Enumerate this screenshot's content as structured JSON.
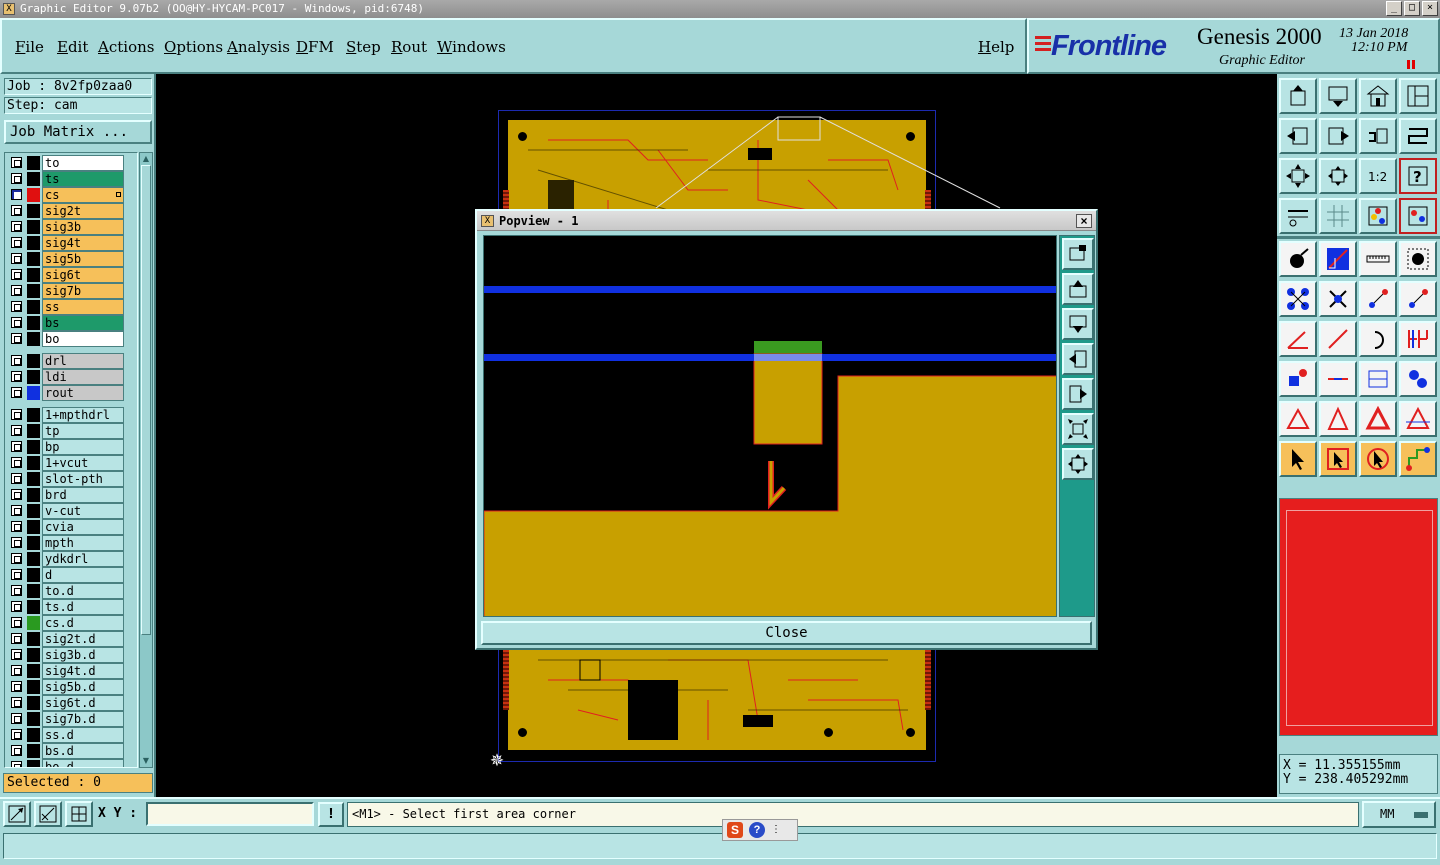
{
  "window": {
    "title": "Graphic Editor 9.07b2 (OO@HY-HYCAM-PC017 - Windows, pid:6748)",
    "app_icon": "X",
    "minimize": "_",
    "maximize": "□",
    "close": "×"
  },
  "menu": {
    "file": "File",
    "edit": "Edit",
    "actions": "Actions",
    "options": "Options",
    "analysis": "Analysis",
    "dfm": "DFM",
    "step": "Step",
    "rout": "Rout",
    "windows": "Windows",
    "help": "Help"
  },
  "brand": {
    "logo": "Frontline",
    "product": "Genesis 2000",
    "subproduct": "Graphic Editor",
    "date": "13 Jan 2018",
    "time": "12:10 PM"
  },
  "job": {
    "job_line": "Job : 8v2fp0zaa0",
    "step_line": "Step: cam",
    "matrix_button": "Job Matrix ..."
  },
  "layers": {
    "board": [
      {
        "name": "to",
        "color": "white",
        "swatch": "#000000"
      },
      {
        "name": "ts",
        "color": "green",
        "swatch": "#000000"
      },
      {
        "name": "cs",
        "color": "orange",
        "swatch": "#e01010",
        "active": true
      },
      {
        "name": "sig2t",
        "color": "orange",
        "swatch": "#000000"
      },
      {
        "name": "sig3b",
        "color": "orange",
        "swatch": "#000000"
      },
      {
        "name": "sig4t",
        "color": "orange",
        "swatch": "#000000"
      },
      {
        "name": "sig5b",
        "color": "orange",
        "swatch": "#000000"
      },
      {
        "name": "sig6t",
        "color": "orange",
        "swatch": "#000000"
      },
      {
        "name": "sig7b",
        "color": "orange",
        "swatch": "#000000"
      },
      {
        "name": "ss",
        "color": "orange",
        "swatch": "#000000"
      },
      {
        "name": "bs",
        "color": "green",
        "swatch": "#000000"
      },
      {
        "name": "bo",
        "color": "white",
        "swatch": "#000000"
      }
    ],
    "drill": [
      {
        "name": "drl",
        "color": "gray",
        "swatch": "#000000"
      },
      {
        "name": "ldi",
        "color": "gray",
        "swatch": "#000000"
      },
      {
        "name": "rout",
        "color": "gray",
        "swatch": "#1030e0"
      }
    ],
    "misc": [
      {
        "name": "1+mpthdrl",
        "color": "teal",
        "swatch": "#000000"
      },
      {
        "name": "tp",
        "color": "teal",
        "swatch": "#000000"
      },
      {
        "name": "bp",
        "color": "teal",
        "swatch": "#000000"
      },
      {
        "name": "1+vcut",
        "color": "teal",
        "swatch": "#000000"
      },
      {
        "name": "slot-pth",
        "color": "teal",
        "swatch": "#000000"
      },
      {
        "name": "brd",
        "color": "teal",
        "swatch": "#000000"
      },
      {
        "name": "v-cut",
        "color": "teal",
        "swatch": "#000000"
      },
      {
        "name": "cvia",
        "color": "teal",
        "swatch": "#000000"
      },
      {
        "name": "mpth",
        "color": "teal",
        "swatch": "#000000"
      },
      {
        "name": "ydkdrl",
        "color": "teal",
        "swatch": "#000000"
      },
      {
        "name": "d",
        "color": "teal",
        "swatch": "#000000"
      },
      {
        "name": "to.d",
        "color": "teal",
        "swatch": "#000000"
      },
      {
        "name": "ts.d",
        "color": "teal",
        "swatch": "#000000"
      },
      {
        "name": "cs.d",
        "color": "teal",
        "swatch": "#2a9a20"
      },
      {
        "name": "sig2t.d",
        "color": "teal",
        "swatch": "#000000"
      },
      {
        "name": "sig3b.d",
        "color": "teal",
        "swatch": "#000000"
      },
      {
        "name": "sig4t.d",
        "color": "teal",
        "swatch": "#000000"
      },
      {
        "name": "sig5b.d",
        "color": "teal",
        "swatch": "#000000"
      },
      {
        "name": "sig6t.d",
        "color": "teal",
        "swatch": "#000000"
      },
      {
        "name": "sig7b.d",
        "color": "teal",
        "swatch": "#000000"
      },
      {
        "name": "ss.d",
        "color": "teal",
        "swatch": "#000000"
      },
      {
        "name": "bs.d",
        "color": "teal",
        "swatch": "#000000"
      },
      {
        "name": "bo.d",
        "color": "teal",
        "swatch": "#000000"
      }
    ],
    "selected": "Selected : 0"
  },
  "popview": {
    "title": "Popview - 1",
    "close_x": "×",
    "close_button": "Close"
  },
  "coords": {
    "x": "X = 11.355155mm",
    "y": "Y = 238.405292mm"
  },
  "status": {
    "xy_label": "X Y :",
    "xy_value": "",
    "warn": "!",
    "prompt": "<M1> - Select first area corner",
    "units": "MM"
  },
  "ime": {
    "s": "S",
    "q": "?",
    "more": "⋮"
  },
  "colors": {
    "panel": "#a6d8d8",
    "board": "#c8a000",
    "trace_red": "#e02020",
    "rout_blue": "#1030e0",
    "overview_red": "#e61e1e"
  }
}
